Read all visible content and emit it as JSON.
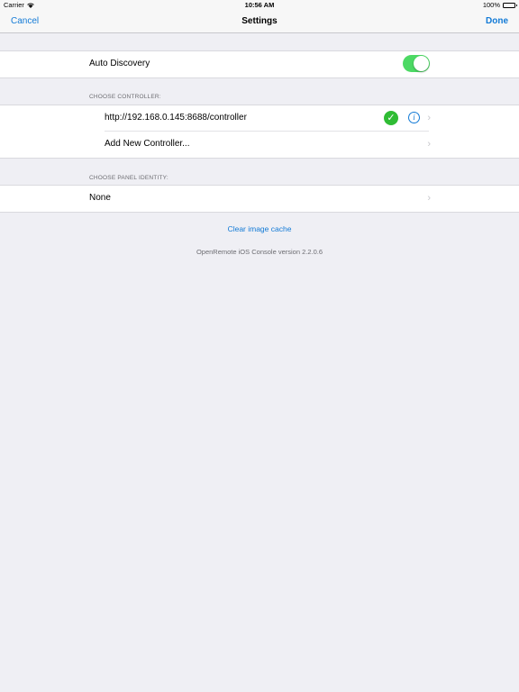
{
  "status_bar": {
    "carrier": "Carrier",
    "wifi_icon": "wifi-icon",
    "time": "10:56 AM",
    "battery": "100%",
    "battery_level": 1.0
  },
  "nav": {
    "cancel_label": "Cancel",
    "title": "Settings",
    "done_label": "Done"
  },
  "auto_discovery": {
    "label": "Auto Discovery",
    "enabled": true
  },
  "controllers": {
    "header": "CHOOSE CONTROLLER:",
    "items": [
      {
        "label": "http://192.168.0.145:8688/controller",
        "selected": true,
        "info_icon": "info-icon"
      },
      {
        "label": "Add New Controller..."
      }
    ]
  },
  "panel_identity": {
    "header": "CHOOSE PANEL IDENTITY:",
    "value": "None"
  },
  "clear_cache_label": "Clear image cache",
  "version_text": "OpenRemote iOS Console version 2.2.0.6",
  "colors": {
    "accent": "#127ad6",
    "toggle_on": "#4cd964",
    "check": "#2fbc34",
    "background": "#efeff4"
  }
}
